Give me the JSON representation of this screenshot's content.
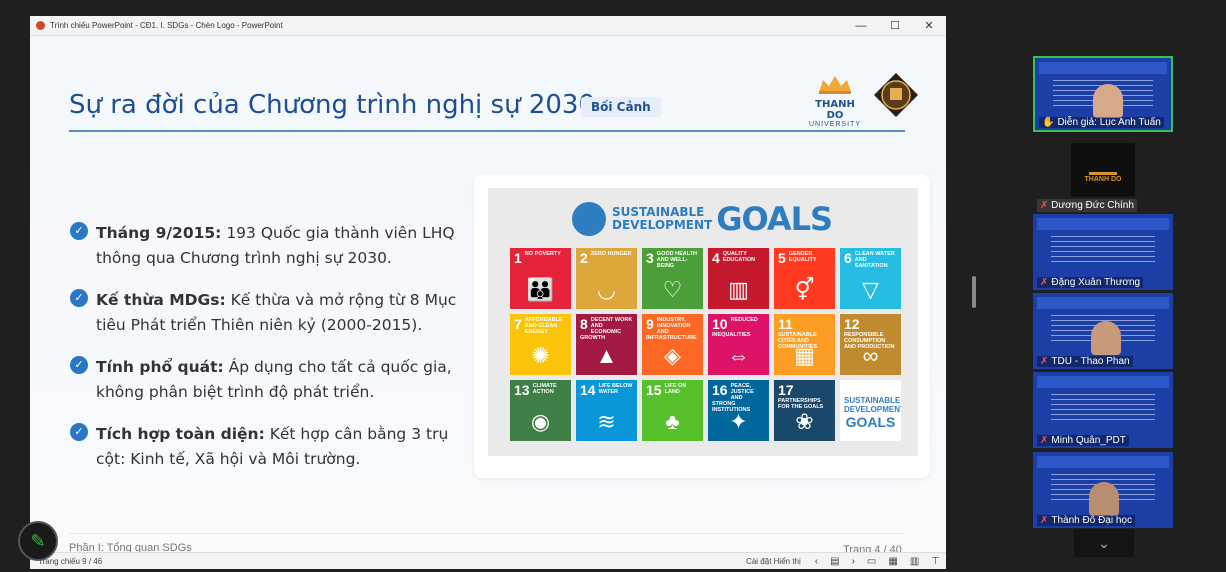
{
  "window": {
    "title": "Trình chiếu PowerPoint  -  CĐ1. I. SDGs - Chèn Logo - PowerPoint",
    "controls": [
      "—",
      "☐",
      "✕"
    ]
  },
  "slide": {
    "title": "Sự ra đời của Chương trình nghị sự 2030",
    "badge": "Bối Cảnh",
    "logo_name": "THANH DO",
    "logo_sub": "UNIVERSITY",
    "bullets": [
      {
        "bold": "Tháng 9/2015:",
        "text": " 193 Quốc gia thành viên LHQ thông qua Chương trình nghị sự 2030."
      },
      {
        "bold": "Kế thừa MDGs:",
        "text": " Kế thừa và mở rộng từ 8 Mục tiêu Phát triển Thiên niên kỷ (2000-2015)."
      },
      {
        "bold": "Tính phổ quát:",
        "text": " Áp dụng cho tất cả quốc gia, không phân biệt trình độ phát triển."
      },
      {
        "bold": "Tích hợp toàn diện:",
        "text": " Kết hợp cân bằng 3 trụ cột: Kinh tế, Xã hội và Môi trường."
      }
    ],
    "footer_section": "Phần I: Tổng quan SDGs",
    "footer_page": "Trang 4 / 40",
    "sdg": {
      "header_line1": "SUSTAINABLE",
      "header_line2": "DEVELOPMENT",
      "header_goals": "GOALS",
      "goals": [
        {
          "num": "1",
          "label": "NO POVERTY",
          "color": "#e5243b",
          "icon": "family-icon"
        },
        {
          "num": "2",
          "label": "ZERO HUNGER",
          "color": "#dda63a",
          "icon": "bowl-icon"
        },
        {
          "num": "3",
          "label": "GOOD HEALTH AND WELL-BEING",
          "color": "#4c9f38",
          "icon": "heartbeat-icon"
        },
        {
          "num": "4",
          "label": "QUALITY EDUCATION",
          "color": "#c5192d",
          "icon": "book-icon"
        },
        {
          "num": "5",
          "label": "GENDER EQUALITY",
          "color": "#ff3a21",
          "icon": "gender-icon"
        },
        {
          "num": "6",
          "label": "CLEAN WATER AND SANITATION",
          "color": "#26bde2",
          "icon": "water-icon"
        },
        {
          "num": "7",
          "label": "AFFORDABLE AND CLEAN ENERGY",
          "color": "#fcc30b",
          "icon": "sun-icon"
        },
        {
          "num": "8",
          "label": "DECENT WORK AND ECONOMIC GROWTH",
          "color": "#a21942",
          "icon": "growth-chart-icon"
        },
        {
          "num": "9",
          "label": "INDUSTRY, INNOVATION AND INFRASTRUCTURE",
          "color": "#fd6925",
          "icon": "cubes-icon"
        },
        {
          "num": "10",
          "label": "REDUCED INEQUALITIES",
          "color": "#dd1367",
          "icon": "equal-icon"
        },
        {
          "num": "11",
          "label": "SUSTAINABLE CITIES AND COMMUNITIES",
          "color": "#fd9d24",
          "icon": "city-icon"
        },
        {
          "num": "12",
          "label": "RESPONSIBLE CONSUMPTION AND PRODUCTION",
          "color": "#bf8b2e",
          "icon": "infinity-icon"
        },
        {
          "num": "13",
          "label": "CLIMATE ACTION",
          "color": "#3f7e44",
          "icon": "eye-icon"
        },
        {
          "num": "14",
          "label": "LIFE BELOW WATER",
          "color": "#0a97d9",
          "icon": "fish-icon"
        },
        {
          "num": "15",
          "label": "LIFE ON LAND",
          "color": "#56c02b",
          "icon": "tree-icon"
        },
        {
          "num": "16",
          "label": "PEACE, JUSTICE AND STRONG INSTITUTIONS",
          "color": "#00689d",
          "icon": "dove-icon"
        },
        {
          "num": "17",
          "label": "PARTNERSHIPS FOR THE GOALS",
          "color": "#19486a",
          "icon": "rings-icon"
        }
      ],
      "logo_tile_line1": "SUSTAINABLE",
      "logo_tile_line2": "DEVELOPMENT",
      "logo_tile_goals": "GOALS"
    }
  },
  "statusbar": {
    "slide_count": "Trang chiếu 9 / 46",
    "display_settings": "Cài đặt Hiển thị"
  },
  "participants": [
    {
      "name": "Diễn giả: Lục Anh Tuấn",
      "active": true
    },
    {
      "name": "Dương Đức Chính",
      "logo_text": "THANH DO"
    },
    {
      "name": "Đặng Xuân Thương"
    },
    {
      "name": "TDU - Thao Phan"
    },
    {
      "name": "Minh Quân_PDT"
    },
    {
      "name": "Thành Đô Đại học"
    }
  ]
}
